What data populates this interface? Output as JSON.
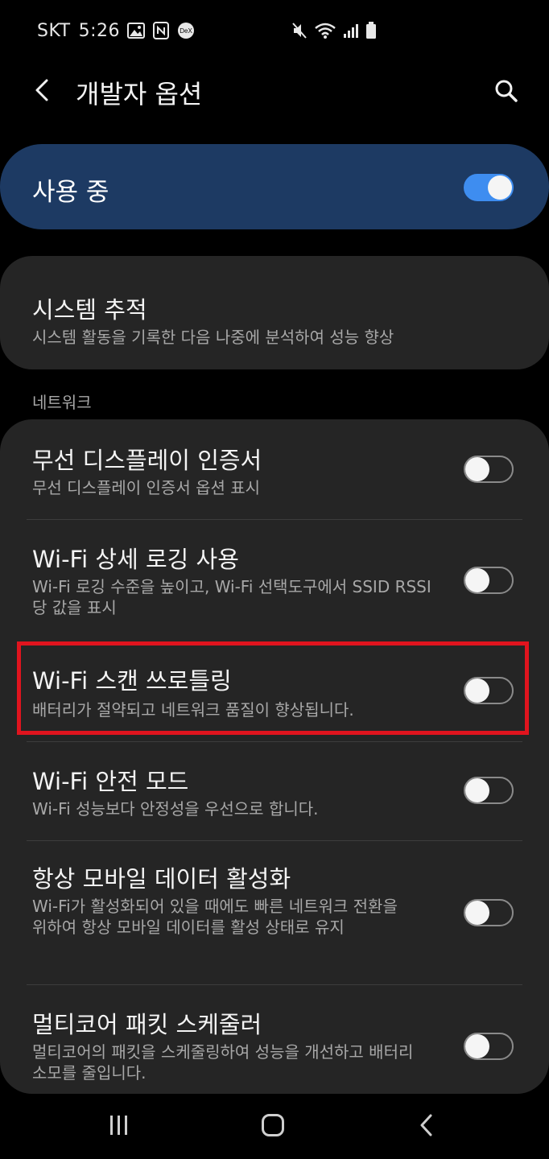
{
  "status_bar": {
    "carrier": "SKT",
    "time": "5:26",
    "left_icons": [
      "gallery-icon",
      "nfc-icon",
      "dex-icon"
    ],
    "dex_label": "DeX",
    "right_icons": [
      "mute-icon",
      "wifi-icon",
      "signal-icon",
      "battery-icon"
    ]
  },
  "app_bar": {
    "title": "개발자 옵션",
    "back_icon": "chevron-left-icon",
    "search_icon": "search-icon"
  },
  "master_switch": {
    "label": "사용 중",
    "enabled": true
  },
  "system_trace": {
    "title": "시스템 추적",
    "subtitle": "시스템 활동을 기록한 다음 나중에 분석하여 성능 향상"
  },
  "network_section": {
    "header": "네트워크",
    "items": [
      {
        "title": "무선 디스플레이 인증서",
        "subtitle": "무선 디스플레이 인증서 옵션 표시",
        "enabled": false
      },
      {
        "title": "Wi-Fi 상세 로깅 사용",
        "subtitle": "Wi-Fi 로깅 수준을 높이고, Wi-Fi 선택도구에서 SSID RSSI당 값을 표시",
        "enabled": false
      },
      {
        "title": "Wi-Fi 스캔 쓰로틀링",
        "subtitle": "배터리가 절약되고 네트워크 품질이 향상됩니다.",
        "enabled": false,
        "highlighted": true
      },
      {
        "title": "Wi-Fi 안전 모드",
        "subtitle": "Wi-Fi 성능보다 안정성을 우선으로 합니다.",
        "enabled": false
      },
      {
        "title": "항상 모바일 데이터 활성화",
        "subtitle": "Wi-Fi가 활성화되어 있을 때에도 빠른 네트워크 전환을 위하여 항상 모바일 데이터를 활성 상태로 유지",
        "enabled": false
      },
      {
        "title": "멀티코어 패킷 스케줄러",
        "subtitle": "멀티코어의 패킷을 스케줄링하여 성능을 개선하고 배터리 소모를 줄입니다.",
        "enabled": false
      }
    ]
  },
  "nav_bar": {
    "icons": [
      "recents-icon",
      "home-icon",
      "back-icon"
    ]
  },
  "colors": {
    "background": "#000000",
    "card": "#252525",
    "master_card": "#1d3a63",
    "accent": "#3e8df0",
    "highlight": "#e0141e",
    "subtitle_text": "#a8a8a8"
  }
}
